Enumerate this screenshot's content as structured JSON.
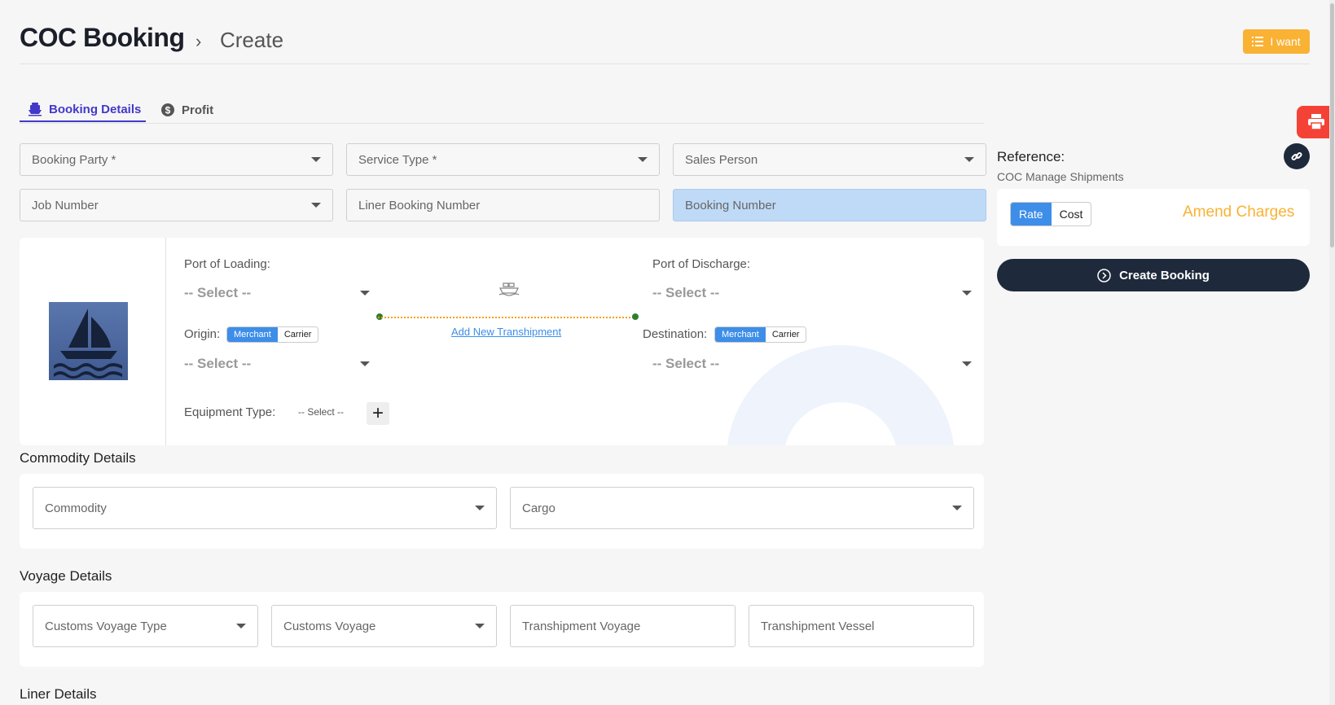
{
  "header": {
    "title": "COC Booking",
    "breadcrumb_sep": "›",
    "breadcrumb": "Create",
    "iwant_label": "I want"
  },
  "tabs": [
    {
      "label": "Booking Details",
      "icon": "ship-icon",
      "active": true
    },
    {
      "label": "Profit",
      "icon": "dollar-icon",
      "active": false
    }
  ],
  "form": {
    "booking_party": "Booking Party *",
    "service_type": "Service Type *",
    "sales_person": "Sales Person",
    "job_number": "Job Number",
    "liner_booking_number": "Liner Booking Number",
    "booking_number": "Booking Number"
  },
  "reference": {
    "label": "Reference:",
    "sub": "COC Manage Shipments",
    "seg_rate": "Rate",
    "seg_cost": "Cost",
    "amend": "Amend Charges",
    "create_booking": "Create Booking"
  },
  "ports": {
    "loading_label": "Port of Loading:",
    "discharge_label": "Port of Discharge:",
    "select_placeholder": "-- Select --",
    "origin_label": "Origin:",
    "destination_label": "Destination:",
    "merchant": "Merchant",
    "carrier": "Carrier",
    "add_transhipment": "Add New Transhipment",
    "equipment_label": "Equipment Type:",
    "equipment_select": "-- Select --",
    "plus": "+"
  },
  "commodity": {
    "title": "Commodity Details",
    "commodity": "Commodity",
    "cargo": "Cargo"
  },
  "voyage": {
    "title": "Voyage Details",
    "customs_voyage_type": "Customs Voyage Type",
    "customs_voyage": "Customs Voyage",
    "transhipment_voyage": "Transhipment Voyage",
    "transhipment_vessel": "Transhipment Vessel"
  },
  "liner": {
    "title": "Liner Details"
  },
  "colors": {
    "accent": "#4338ca",
    "orange": "#f9b233",
    "dark": "#1e2a3b",
    "blue": "#3d8ee9",
    "red": "#f44336"
  }
}
